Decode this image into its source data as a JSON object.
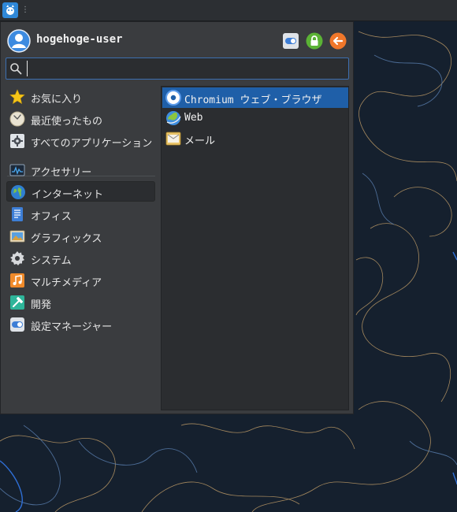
{
  "panel": {
    "menu_icon": "whisker-menu-icon"
  },
  "user": {
    "name": "hogehoge-user",
    "avatar_icon": "user-avatar-icon"
  },
  "actions": [
    {
      "name": "settings-manager-button",
      "icon": "toggle-settings-icon"
    },
    {
      "name": "lock-screen-button",
      "icon": "lock-icon"
    },
    {
      "name": "log-out-button",
      "icon": "back-arrow-icon"
    }
  ],
  "search": {
    "value": "",
    "placeholder": ""
  },
  "categories": [
    {
      "label": "お気に入り",
      "icon": "star-icon"
    },
    {
      "label": "最近使ったもの",
      "icon": "clock-icon"
    },
    {
      "label": "すべてのアプリケーション",
      "icon": "gear-icon"
    },
    {
      "label": "アクセサリー",
      "icon": "pulse-icon"
    },
    {
      "label": "インターネット",
      "icon": "globe-icon",
      "active": true
    },
    {
      "label": "オフィス",
      "icon": "document-icon"
    },
    {
      "label": "グラフィックス",
      "icon": "image-icon"
    },
    {
      "label": "システム",
      "icon": "cog-icon"
    },
    {
      "label": "マルチメディア",
      "icon": "music-icon"
    },
    {
      "label": "開発",
      "icon": "hammer-icon"
    },
    {
      "label": "設定マネージャー",
      "icon": "toggle-icon"
    }
  ],
  "apps": [
    {
      "label": "Chromium ウェブ・ブラウザ",
      "icon": "chromium-icon",
      "selected": true
    },
    {
      "label": "Web",
      "icon": "web-globe-icon"
    },
    {
      "label": "メール",
      "icon": "mail-icon"
    }
  ],
  "colors": {
    "accent": "#1f5fa8",
    "menu_bg": "#3a3c3f",
    "wallpaper": "#15202e"
  }
}
